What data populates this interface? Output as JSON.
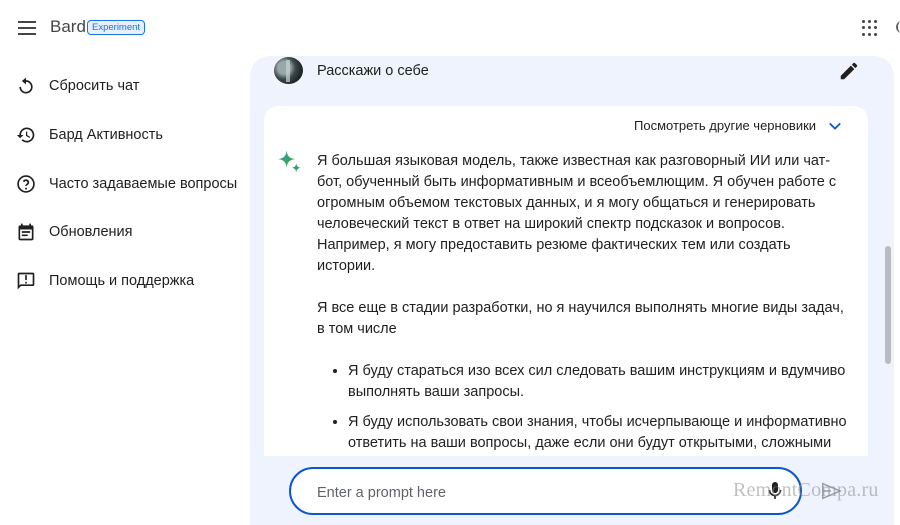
{
  "header": {
    "brand": "Bard",
    "badge": "Experiment"
  },
  "sidebar": {
    "items": [
      {
        "label": "Сбросить чат",
        "icon": "reset-icon"
      },
      {
        "label": "Бард Активность",
        "icon": "history-icon"
      },
      {
        "label": "Часто задаваемые вопросы",
        "icon": "help-circle-icon"
      },
      {
        "label": "Обновления",
        "icon": "calendar-icon"
      },
      {
        "label": "Помощь и поддержка",
        "icon": "feedback-icon"
      }
    ]
  },
  "chat": {
    "user_prompt": "Расскажи о себе",
    "drafts_label": "Посмотреть другие черновики",
    "response": {
      "p1": "Я большая языковая модель, также известная как разговорный ИИ или чат-бот, обученный быть информативным и всеобъемлющим. Я обучен работе с огромным объемом текстовых данных, и я могу общаться и генерировать человеческий текст в ответ на широкий спектр подсказок и вопросов. Например, я могу предоставить резюме фактических тем или создать истории.",
      "p2": "Я все еще в стадии разработки, но я научился выполнять многие виды задач, в том числе",
      "bullets": [
        "Я буду стараться изо всех сил следовать вашим инструкциям и вдумчиво выполнять ваши запросы.",
        "Я буду использовать свои знания, чтобы исчерпывающе и информативно ответить на ваши вопросы, даже если они будут открытыми, сложными"
      ]
    }
  },
  "input": {
    "placeholder": "Enter a prompt here"
  },
  "watermark": "RemontCompa.ru",
  "colors": {
    "accent": "#0b57d0",
    "badge": "#1a73e8",
    "chat_bg": "#eef3fd"
  }
}
